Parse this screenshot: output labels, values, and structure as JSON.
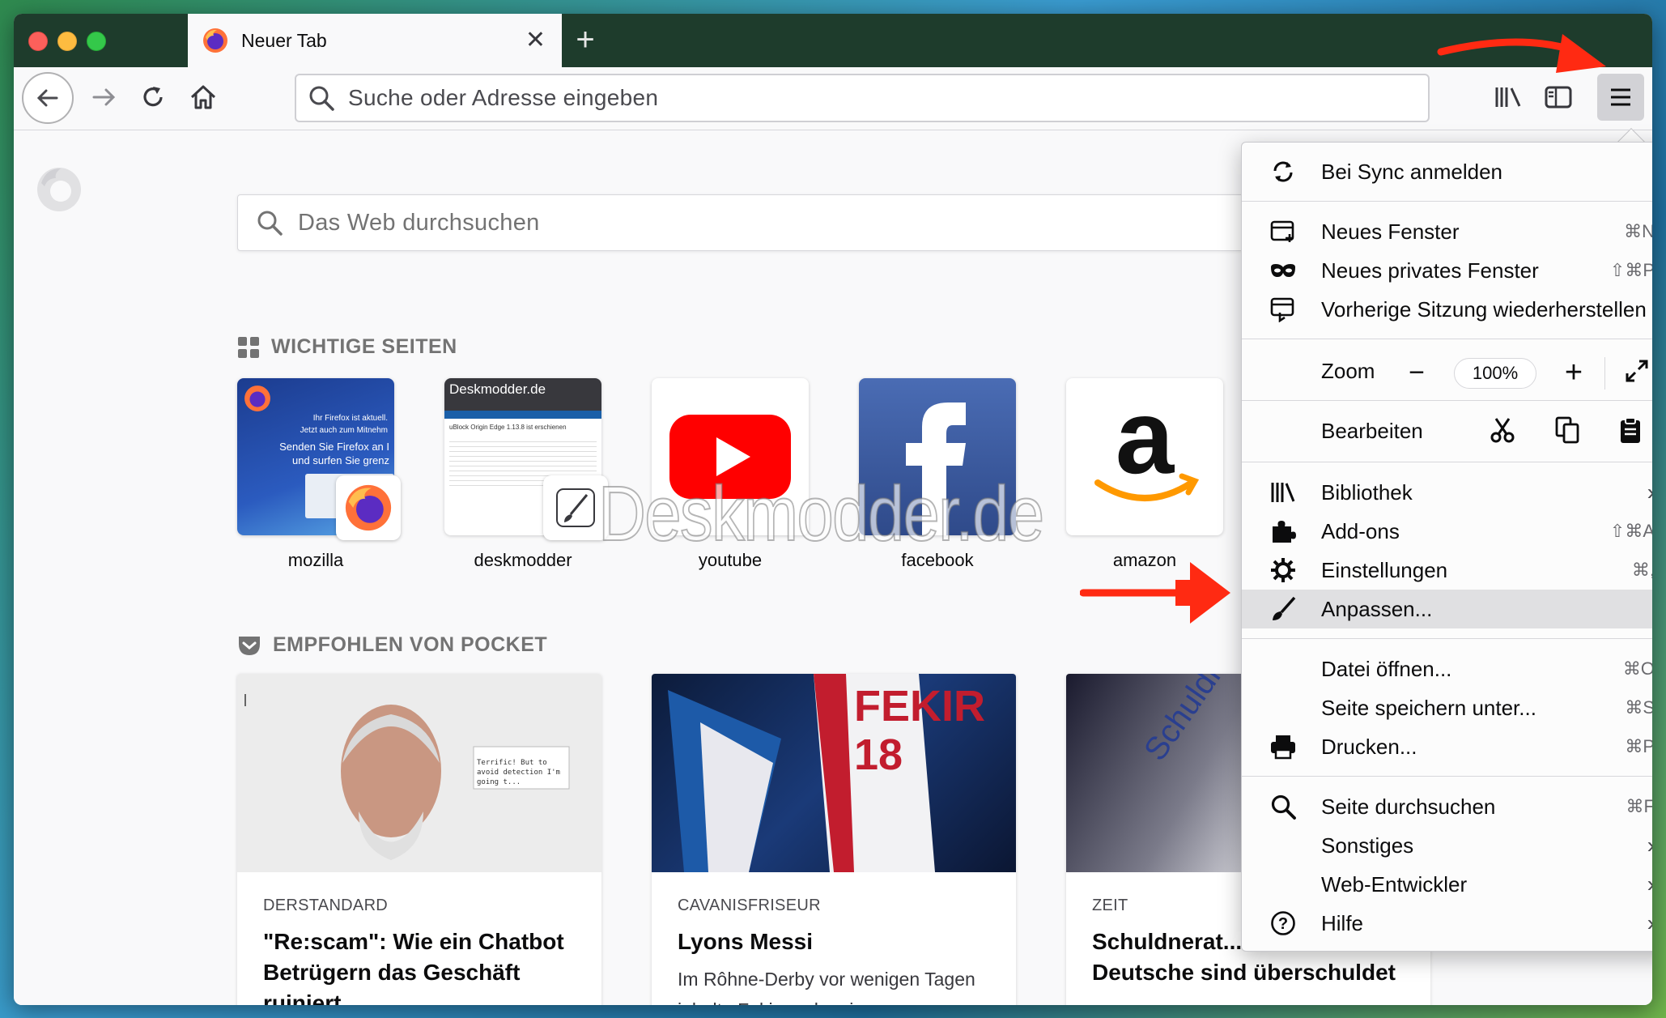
{
  "browser": {
    "tab_title": "Neuer Tab",
    "urlbar_placeholder": "Suche oder Adresse eingeben"
  },
  "newtab": {
    "search_placeholder": "Das Web durchsuchen",
    "topsites_heading": "WICHTIGE SEITEN",
    "topsites": [
      {
        "label": "mozilla",
        "thumb_lines": [
          "Ihr Firefox ist aktuell.",
          "Jetzt auch zum Mitnehm",
          "Senden Sie Firefox an I",
          "und surfen Sie grenz"
        ]
      },
      {
        "label": "deskmodder",
        "thumb_lines": [
          "Deskmodder.de",
          "uBlock Origin Edge 1.13.8 ist erschienen"
        ]
      },
      {
        "label": "youtube"
      },
      {
        "label": "facebook"
      },
      {
        "label": "amazon"
      }
    ],
    "watermark": "Deskmodder.de",
    "pocket_heading": "EMPFOHLEN VON POCKET",
    "cards": [
      {
        "source": "DERSTANDARD",
        "title": "\"Re:scam\": Wie ein Chatbot Betrügern das Geschäft ruiniert",
        "excerpt": "",
        "img_text": "Terrific! But to avoid detection I'm going t..."
      },
      {
        "source": "CAVANISFRISEUR",
        "title": "Lyons Messi",
        "excerpt": "Im Rôhne-Derby vor wenigen Tagen jubelte Fekir nach seinem",
        "img_text": "FEKIR 18"
      },
      {
        "source": "ZEIT",
        "title": "Schuldnerat... Immer mehr Deutsche sind überschuldet",
        "excerpt": "",
        "img_text": "Schuldner Deutsc"
      }
    ]
  },
  "menu": {
    "sync": "Bei Sync anmelden",
    "new_window": "Neues Fenster",
    "new_window_sc": "⌘N",
    "private_window": "Neues privates Fenster",
    "private_window_sc": "⇧⌘P",
    "restore_session": "Vorherige Sitzung wiederherstellen",
    "zoom_label": "Zoom",
    "zoom_value": "100%",
    "edit_label": "Bearbeiten",
    "library": "Bibliothek",
    "addons": "Add-ons",
    "addons_sc": "⇧⌘A",
    "preferences": "Einstellungen",
    "preferences_sc": "⌘,",
    "customize": "Anpassen...",
    "open_file": "Datei öffnen...",
    "open_file_sc": "⌘O",
    "save_page": "Seite speichern unter...",
    "save_page_sc": "⌘S",
    "print": "Drucken...",
    "print_sc": "⌘P",
    "find": "Seite durchsuchen",
    "find_sc": "⌘F",
    "more": "Sonstiges",
    "web_dev": "Web-Entwickler",
    "help": "Hilfe"
  },
  "colors": {
    "annotation_arrow": "#ff2a12",
    "youtube": "#ff0000",
    "facebook": "#3b5998",
    "amazon_orange": "#ff9900"
  }
}
